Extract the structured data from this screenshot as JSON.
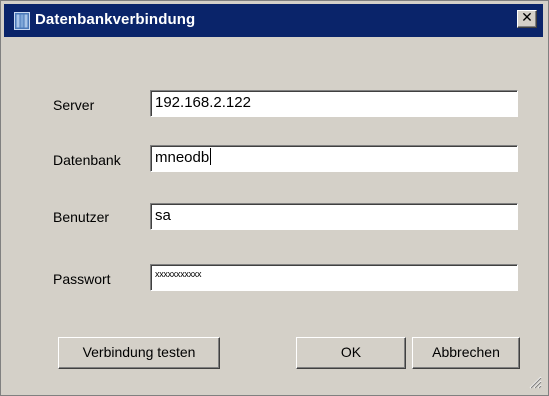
{
  "window": {
    "title": "Datenbankverbindung",
    "title_icon": "database-app-icon",
    "close_glyph": "✕",
    "close_icon": "close-icon"
  },
  "form": {
    "server_label": "Server",
    "server_value": "192.168.2.122",
    "database_label": "Datenbank",
    "database_value": "mneodb",
    "user_label": "Benutzer",
    "user_value": "sa",
    "password_label": "Passwort",
    "password_value": "xxxxxxxxxxx"
  },
  "buttons": {
    "test_label": "Verbindung testen",
    "ok_label": "OK",
    "cancel_label": "Abbrechen"
  },
  "colors": {
    "titlebar": "#0a246a",
    "dialog_face": "#d4d0c8"
  }
}
